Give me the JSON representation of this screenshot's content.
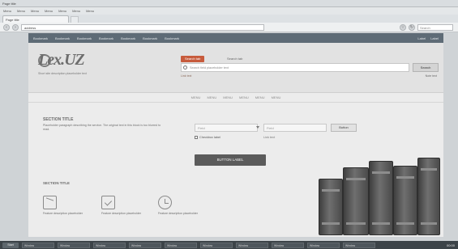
{
  "browser": {
    "window_title": "Page title",
    "menu": [
      "Menu",
      "Menu",
      "Menu",
      "Menu",
      "Menu",
      "Menu",
      "Menu"
    ],
    "tab_title": "Page title",
    "url": "address",
    "search_placeholder": "Search",
    "bookmarks": [
      "Bookmark",
      "Bookmark",
      "Bookmark",
      "Bookmark",
      "Bookmark",
      "Bookmark",
      "Bookmark"
    ],
    "bookmarks_right": [
      "Label",
      "Label"
    ]
  },
  "site": {
    "logo": "Lex.UZ",
    "tagline": "Short site description placeholder text",
    "search_tabs": [
      "Search tab",
      "Search tab"
    ],
    "search_placeholder": "Search field placeholder text",
    "search_button": "Search",
    "advanced_link": "Link text",
    "right_note": "Note text",
    "main_menu": [
      "MENU",
      "MENU",
      "MENU",
      "MENU",
      "MENU",
      "MENU"
    ],
    "about_title": "SECTION TITLE",
    "about_text": "Placeholder paragraph describing the service. The original text in this block is too blurred to read.",
    "login_placeholder": "Field",
    "password_placeholder": "Field",
    "login_button": "Button",
    "remember_label": "Checkbox label",
    "forgot_label": "Link text",
    "register_button": "BUTTON LABEL",
    "features_title": "SECTION TITLE",
    "features": [
      {
        "icon": "mail-icon",
        "text": "Feature description placeholder"
      },
      {
        "icon": "check-icon",
        "text": "Feature description placeholder"
      },
      {
        "icon": "clock-icon",
        "text": "Feature description placeholder"
      }
    ]
  },
  "taskbar": {
    "start": "Start",
    "items": [
      "Window",
      "Window",
      "Window",
      "Window",
      "Window",
      "Window",
      "Window",
      "Window",
      "Window",
      "Window"
    ],
    "clock": "00:00"
  },
  "colors": {
    "accent": "#c75b3c",
    "nav_bg": "#5e6b76",
    "register_bg": "#5b5b5b"
  }
}
